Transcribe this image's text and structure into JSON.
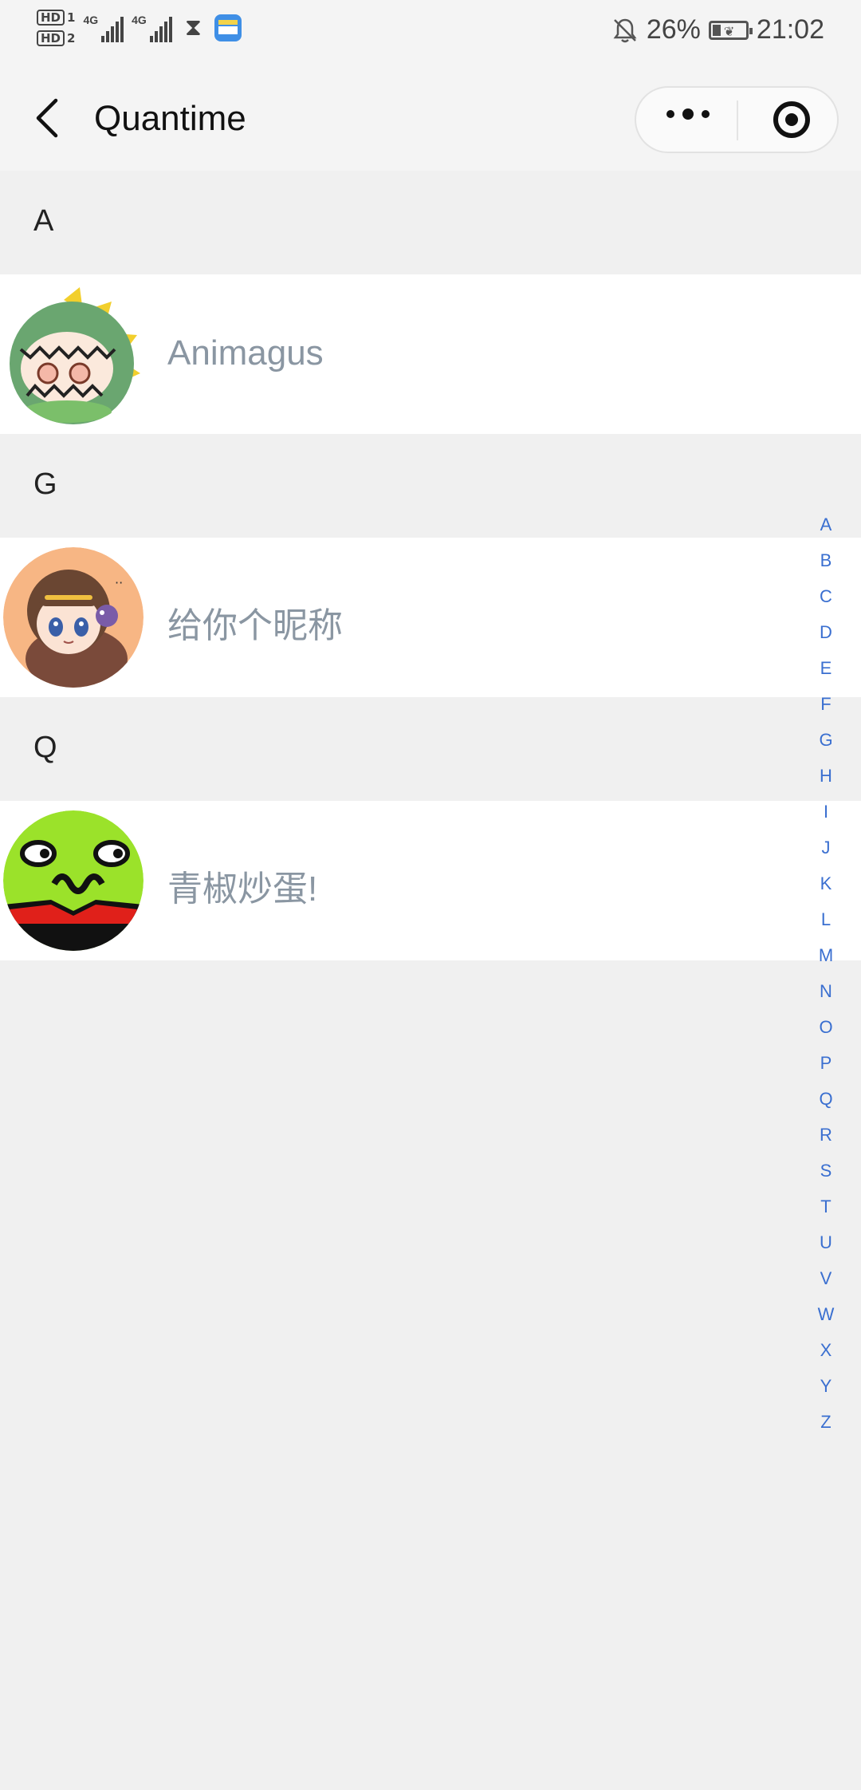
{
  "status_bar": {
    "sim1": "HD",
    "sim1_index": "1",
    "sim2": "HD",
    "sim2_index": "2",
    "net1": "4G",
    "net2": "4G",
    "battery_percent": "26%",
    "time": "21:02",
    "battery_level": 0.26
  },
  "title_bar": {
    "title": "Quantime"
  },
  "sections": [
    {
      "letter": "A",
      "contacts": [
        {
          "name": "Animagus",
          "avatar": "green-dinosaur-avatar"
        }
      ]
    },
    {
      "letter": "G",
      "contacts": [
        {
          "name": "给你个昵称",
          "avatar": "anime-girl-avatar"
        }
      ]
    },
    {
      "letter": "Q",
      "contacts": [
        {
          "name": "青椒炒蛋!",
          "avatar": "green-face-avatar"
        }
      ]
    }
  ],
  "index_letters": [
    "A",
    "B",
    "C",
    "D",
    "E",
    "F",
    "G",
    "H",
    "I",
    "J",
    "K",
    "L",
    "M",
    "N",
    "O",
    "P",
    "Q",
    "R",
    "S",
    "T",
    "U",
    "V",
    "W",
    "X",
    "Y",
    "Z"
  ],
  "colors": {
    "page_background": "#f0f0f0",
    "row_background": "#ffffff",
    "contact_name": "#8a96a2",
    "index_letter": "#3a6fd0"
  }
}
